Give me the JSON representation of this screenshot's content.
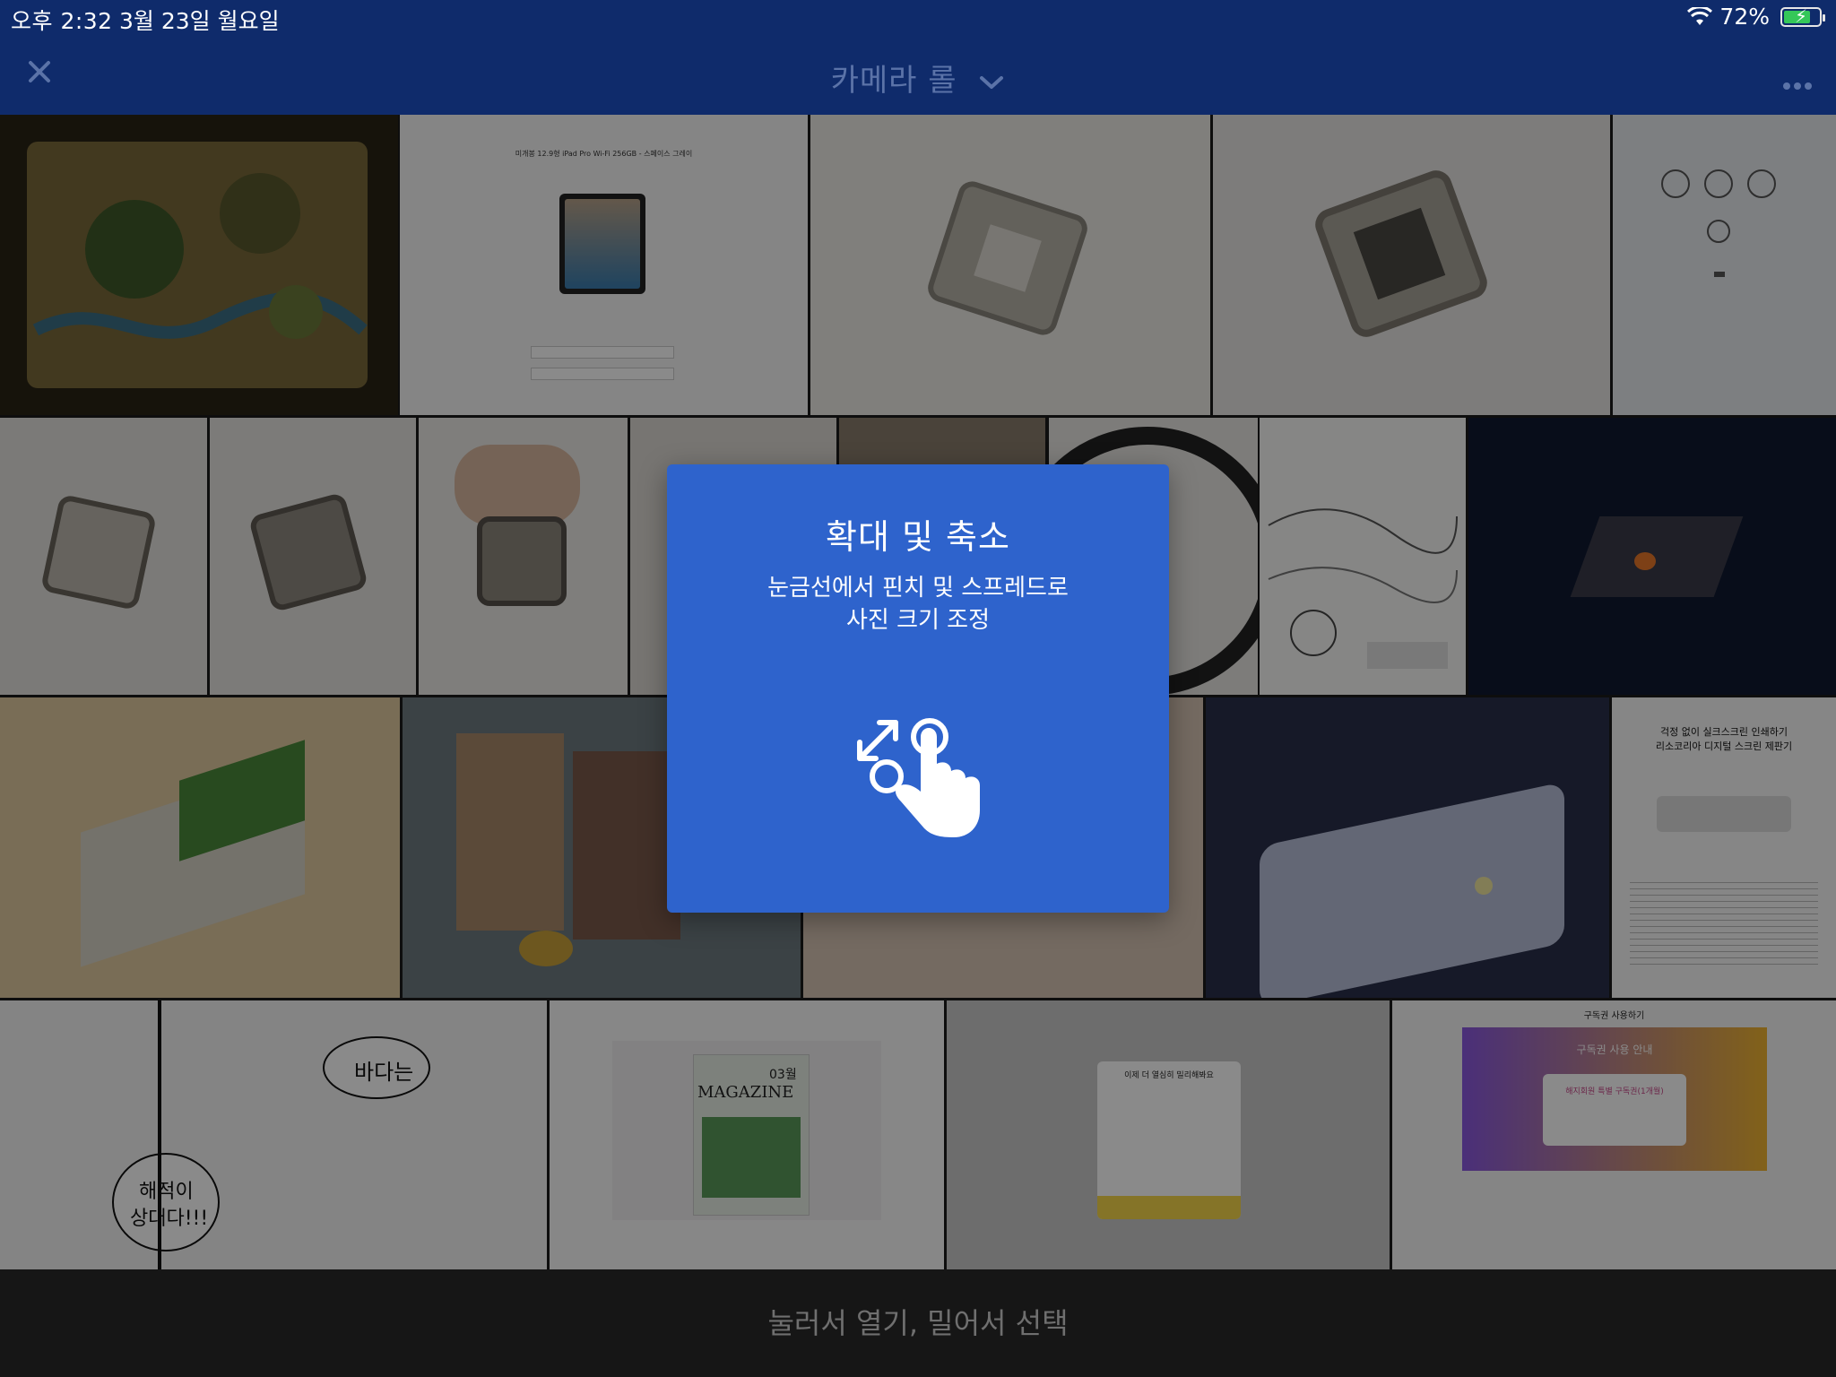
{
  "status_bar": {
    "time": "오후 2:32",
    "date": "3월 23일 월요일",
    "battery": "72%",
    "battery_level": 0.72
  },
  "nav": {
    "title": "카메라 롤",
    "close_icon": "close-icon",
    "more_icon": "more-icon"
  },
  "tip": {
    "title": "확대 및 축소",
    "desc_line1": "눈금선에서 핀치 및 스프레드로",
    "desc_line2": "사진 크기 조정",
    "icon": "pinch-gesture-icon"
  },
  "bottom_hint": "눌러서 열기, 밀어서 선택",
  "thumbnails": {
    "manga_text_1": "바다는",
    "manga_text_2": "해적이",
    "manga_text_3": "상대다!!!",
    "magazine_month": "03월",
    "magazine_title": "MAGAZINE",
    "subscription_title": "구독권 사용하기",
    "subscription_banner": "구독권 사용 안내",
    "subscription_card": "해지회원 특별 구독권(1개월)",
    "popup_title": "이제 더 열심히 밀리해봐요",
    "printer_title_1": "걱정 없이 실크스크린 인쇄하기",
    "printer_title_2": "리소코리아 디지털 스크린 제판기",
    "ipad_product": "미개봉 12.9형 iPad Pro Wi-Fi 256GB - 스페이스 그레이"
  },
  "colors": {
    "nav_bg": "#0f2b6b",
    "modal_bg": "#2e63cc",
    "battery_green": "#35c759"
  }
}
